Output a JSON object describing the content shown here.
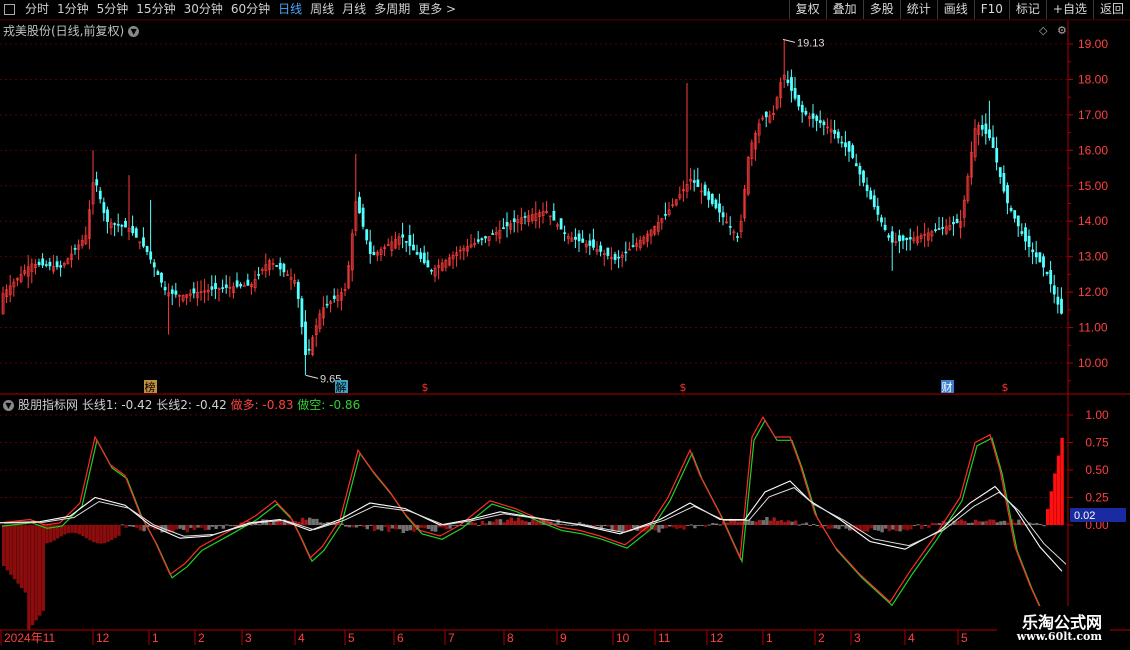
{
  "toolbar": {
    "periods": [
      "分时",
      "1分钟",
      "5分钟",
      "15分钟",
      "30分钟",
      "60分钟",
      "日线",
      "周线",
      "月线",
      "多周期",
      "更多 >"
    ],
    "active_period": "日线",
    "right_buttons": [
      "复权",
      "叠加",
      "多股",
      "统计",
      "画线",
      "F10",
      "标记",
      "+自选",
      "返回"
    ]
  },
  "main_chart": {
    "title": "戎美股份(日线,前复权)",
    "high_label": "19.13",
    "low_label": "9.65",
    "y_ticks": [
      "19.00",
      "18.00",
      "17.00",
      "16.00",
      "15.00",
      "14.00",
      "13.00",
      "12.00",
      "11.00",
      "10.00"
    ],
    "markers": [
      "榜",
      "解",
      "$",
      "$",
      "财",
      "$"
    ],
    "colors": {
      "up": "#ff3c3c",
      "down": "#54ffff",
      "grid": "#5a0000",
      "axis": "#b00000"
    }
  },
  "indicator": {
    "name": "股朋指标网",
    "items": [
      {
        "label": "长线1:",
        "value": "-0.42",
        "color": "white"
      },
      {
        "label": "长线2:",
        "value": "-0.42",
        "color": "white"
      },
      {
        "label": "做多:",
        "value": "-0.83",
        "color": "red"
      },
      {
        "label": "做空:",
        "value": "-0.86",
        "color": "green"
      }
    ],
    "y_ticks": [
      "1.00",
      "0.75",
      "0.50",
      "0.25",
      "0.00"
    ],
    "current_value": "0.02"
  },
  "x_axis": {
    "labels": [
      "2024年11",
      "12",
      "1",
      "2",
      "3",
      "4",
      "5",
      "6",
      "7",
      "8",
      "9",
      "10",
      "11",
      "12",
      "1",
      "2",
      "3",
      "4",
      "5"
    ]
  },
  "watermark": {
    "title": "乐淘公式网",
    "url": "www.60lt.com"
  },
  "chart_data": {
    "type": "candlestick",
    "y_range": [
      9.5,
      19.4
    ],
    "high": 19.13,
    "low": 9.65,
    "indicator_range": [
      -0.15,
      1.0
    ]
  }
}
